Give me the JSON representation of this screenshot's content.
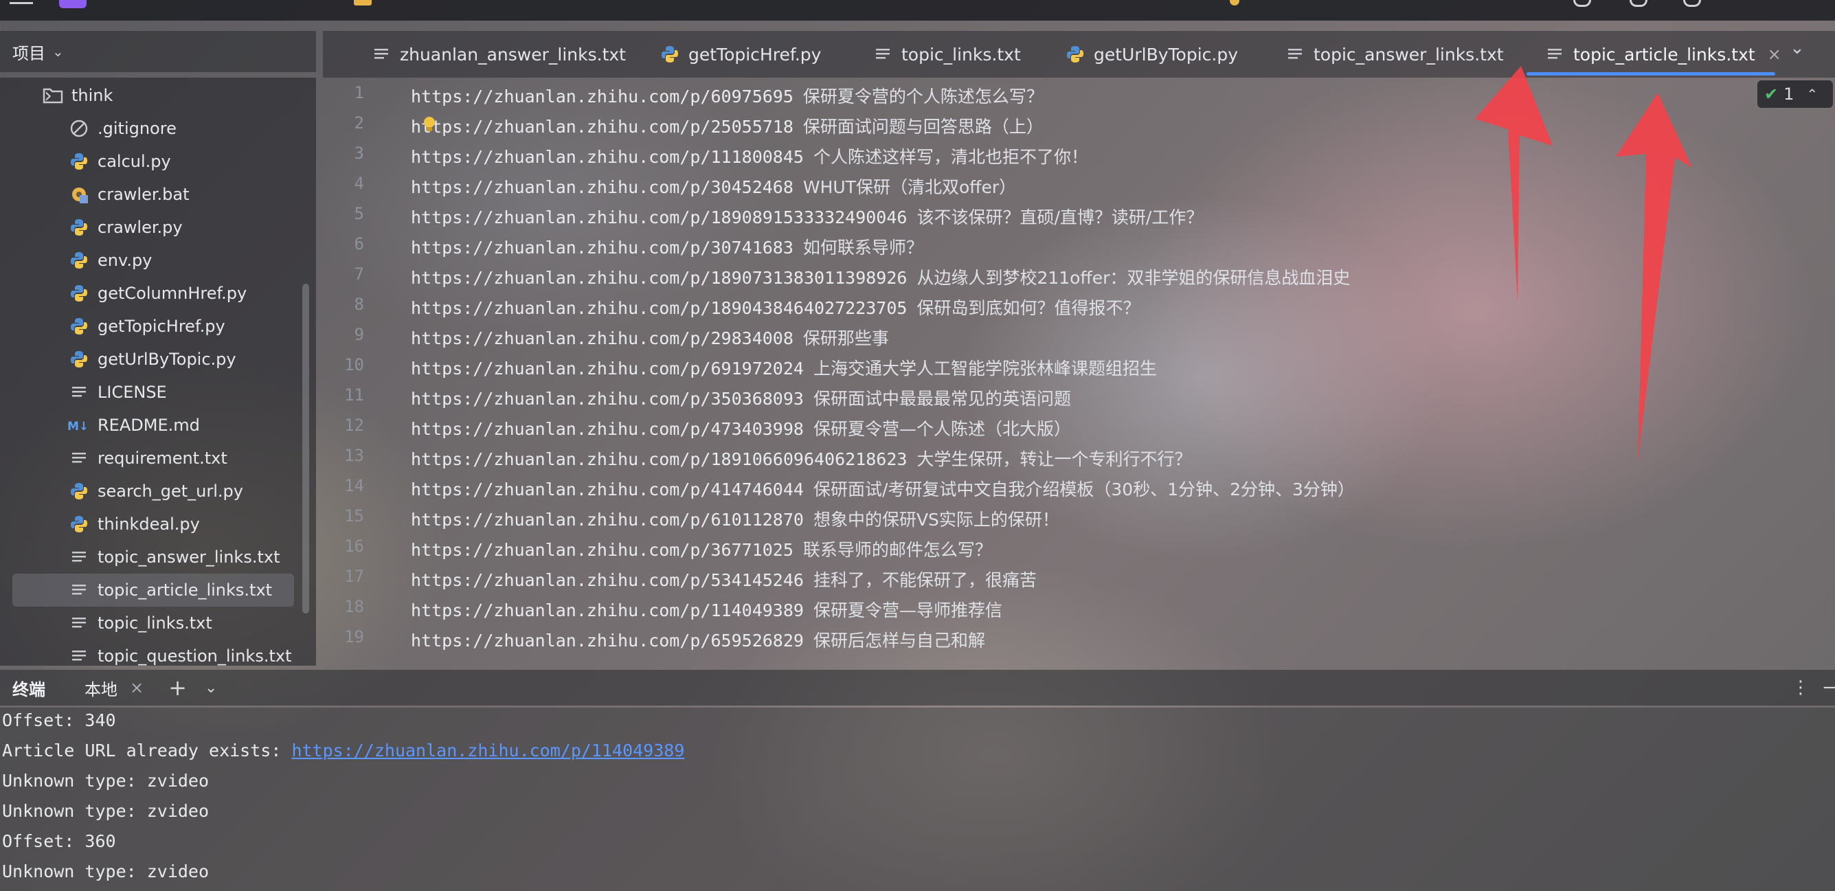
{
  "project_panel": {
    "title": "项目",
    "items": [
      {
        "label": "think",
        "icon": "folder-icon",
        "type": "folder"
      },
      {
        "label": ".gitignore",
        "icon": "ignore-file-icon"
      },
      {
        "label": "calcul.py",
        "icon": "python-file-icon"
      },
      {
        "label": "crawler.bat",
        "icon": "batch-file-icon"
      },
      {
        "label": "crawler.py",
        "icon": "python-file-icon"
      },
      {
        "label": "env.py",
        "icon": "python-file-icon"
      },
      {
        "label": "getColumnHref.py",
        "icon": "python-file-icon"
      },
      {
        "label": "getTopicHref.py",
        "icon": "python-file-icon"
      },
      {
        "label": "getUrlByTopic.py",
        "icon": "python-file-icon"
      },
      {
        "label": "LICENSE",
        "icon": "text-file-icon"
      },
      {
        "label": "README.md",
        "icon": "markdown-file-icon"
      },
      {
        "label": "requirement.txt",
        "icon": "text-file-icon"
      },
      {
        "label": "search_get_url.py",
        "icon": "python-file-icon"
      },
      {
        "label": "thinkdeal.py",
        "icon": "python-file-icon"
      },
      {
        "label": "topic_answer_links.txt",
        "icon": "text-file-icon"
      },
      {
        "label": "topic_article_links.txt",
        "icon": "text-file-icon",
        "selected": true
      },
      {
        "label": "topic_links.txt",
        "icon": "text-file-icon"
      },
      {
        "label": "topic_question_links.txt",
        "icon": "text-file-icon"
      }
    ]
  },
  "editor_tabs": [
    {
      "label": "zhuanlan_answer_links.txt",
      "icon": "text-file-icon"
    },
    {
      "label": "getTopicHref.py",
      "icon": "python-file-icon"
    },
    {
      "label": "topic_links.txt",
      "icon": "text-file-icon"
    },
    {
      "label": "getUrlByTopic.py",
      "icon": "python-file-icon"
    },
    {
      "label": "topic_answer_links.txt",
      "icon": "text-file-icon"
    },
    {
      "label": "topic_article_links.txt",
      "icon": "text-file-icon",
      "active": true
    }
  ],
  "inspection_badge": {
    "count": "1"
  },
  "editor_lines": [
    {
      "num": "1",
      "url": "https://zhuanlan.zhihu.com/p/60975695",
      "text": "保研夏令营的个人陈述怎么写？"
    },
    {
      "num": "2",
      "url": "https://zhuanlan.zhihu.com/p/25055718",
      "text": "保研面试问题与回答思路（上）"
    },
    {
      "num": "3",
      "url": "https://zhuanlan.zhihu.com/p/111800845",
      "text": "个人陈述这样写，清北也拒不了你！"
    },
    {
      "num": "4",
      "url": "https://zhuanlan.zhihu.com/p/30452468",
      "text": "WHUT保研（清北双offer）"
    },
    {
      "num": "5",
      "url": "https://zhuanlan.zhihu.com/p/1890891533332490046",
      "text": "该不该保研？直硕/直博？读研/工作？"
    },
    {
      "num": "6",
      "url": "https://zhuanlan.zhihu.com/p/30741683",
      "text": "如何联系导师？"
    },
    {
      "num": "7",
      "url": "https://zhuanlan.zhihu.com/p/1890731383011398926",
      "text": "从边缘人到梦校211offer：双非学姐的保研信息战血泪史"
    },
    {
      "num": "8",
      "url": "https://zhuanlan.zhihu.com/p/1890438464027223705",
      "text": "保研岛到底如何？值得报不？"
    },
    {
      "num": "9",
      "url": "https://zhuanlan.zhihu.com/p/29834008",
      "text": "保研那些事"
    },
    {
      "num": "10",
      "url": "https://zhuanlan.zhihu.com/p/691972024",
      "text": "上海交通大学人工智能学院张林峰课题组招生"
    },
    {
      "num": "11",
      "url": "https://zhuanlan.zhihu.com/p/350368093",
      "text": "保研面试中最最最常见的英语问题"
    },
    {
      "num": "12",
      "url": "https://zhuanlan.zhihu.com/p/473403998",
      "text": "保研夏令营—个人陈述（北大版）"
    },
    {
      "num": "13",
      "url": "https://zhuanlan.zhihu.com/p/1891066096406218623",
      "text": "大学生保研，转让一个专利行不行？"
    },
    {
      "num": "14",
      "url": "https://zhuanlan.zhihu.com/p/414746044",
      "text": "保研面试/考研复试中文自我介绍模板（30秒、1分钟、2分钟、3分钟）"
    },
    {
      "num": "15",
      "url": "https://zhuanlan.zhihu.com/p/610112870",
      "text": "想象中的保研VS实际上的保研！"
    },
    {
      "num": "16",
      "url": "https://zhuanlan.zhihu.com/p/36771025",
      "text": "联系导师的邮件怎么写？"
    },
    {
      "num": "17",
      "url": "https://zhuanlan.zhihu.com/p/534145246",
      "text": "挂科了，不能保研了，很痛苦"
    },
    {
      "num": "18",
      "url": "https://zhuanlan.zhihu.com/p/114049389",
      "text": "保研夏令营—导师推荐信"
    },
    {
      "num": "19",
      "url": "https://zhuanlan.zhihu.com/p/659526829",
      "text": "保研后怎样与自己和解"
    }
  ],
  "terminal": {
    "title": "终端",
    "tab_label": "本地",
    "lines": [
      {
        "text": "Offset: 340",
        "link": ""
      },
      {
        "text": "Article URL already exists: ",
        "link": "https://zhuanlan.zhihu.com/p/114049389"
      },
      {
        "text": "Unknown type: zvideo",
        "link": ""
      },
      {
        "text": "Unknown type: zvideo",
        "link": ""
      },
      {
        "text": "Offset: 360",
        "link": ""
      },
      {
        "text": "Unknown type: zvideo",
        "link": ""
      }
    ]
  },
  "colors": {
    "accent": "#4d8df6",
    "annotation_arrow": "#f2424b",
    "link": "#5a97ff"
  }
}
